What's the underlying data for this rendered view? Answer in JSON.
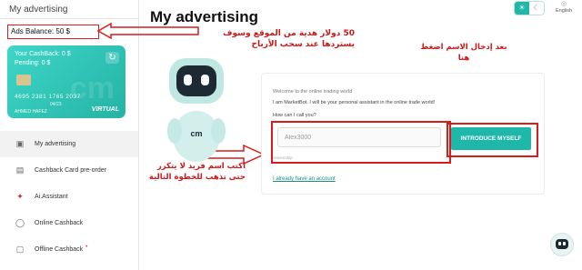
{
  "sidebar": {
    "title": "My advertising",
    "balance": "Ads Balance: 50 $",
    "card": {
      "cashback": "Your CashBack: 0 $",
      "pending": "Pending: 0 $",
      "number": "4695 2381 1765 2037",
      "expiry": "04/23",
      "holder": "AHMED HAFEZ",
      "virtual_label": "VIRTUAL",
      "watermark": "cm"
    },
    "items": [
      {
        "label": "My advertising",
        "icon": "image-icon"
      },
      {
        "label": "Cashback Card pre-order",
        "icon": "card-icon"
      },
      {
        "label": "Ai.Assistant",
        "icon": "ai-icon"
      },
      {
        "label": "Online Cashback",
        "icon": "dollar-icon"
      },
      {
        "label": "Offline Cashback",
        "icon": "store-icon"
      }
    ]
  },
  "header": {
    "title": "My advertising",
    "language": "English",
    "theme_light_icon": "sun-icon",
    "theme_dark_icon": "moon-icon"
  },
  "annotations": {
    "balance_note": "50 دولار هدية من الموقع وسوف يستردها عند سحب الأرباح",
    "button_note": "بعد إدخال الاسم اضغط هنا",
    "name_note": "اكتب اسم فريد لا يتكرر حتى تذهب للخطوة التالية"
  },
  "robot": {
    "badge": "cm"
  },
  "chat": {
    "welcome": "Welcome to the online trading world",
    "intro": "I am MarketBot. I will be your personal assistant in the online trade world!",
    "question": "How can I call you?",
    "name_value": "Alex3000",
    "hint": "censorship",
    "button": "INTRODUCE MYSELF",
    "account_link": "I already have an account"
  },
  "colors": {
    "accent": "#1fb7a9",
    "annotation_red": "#d21616"
  }
}
